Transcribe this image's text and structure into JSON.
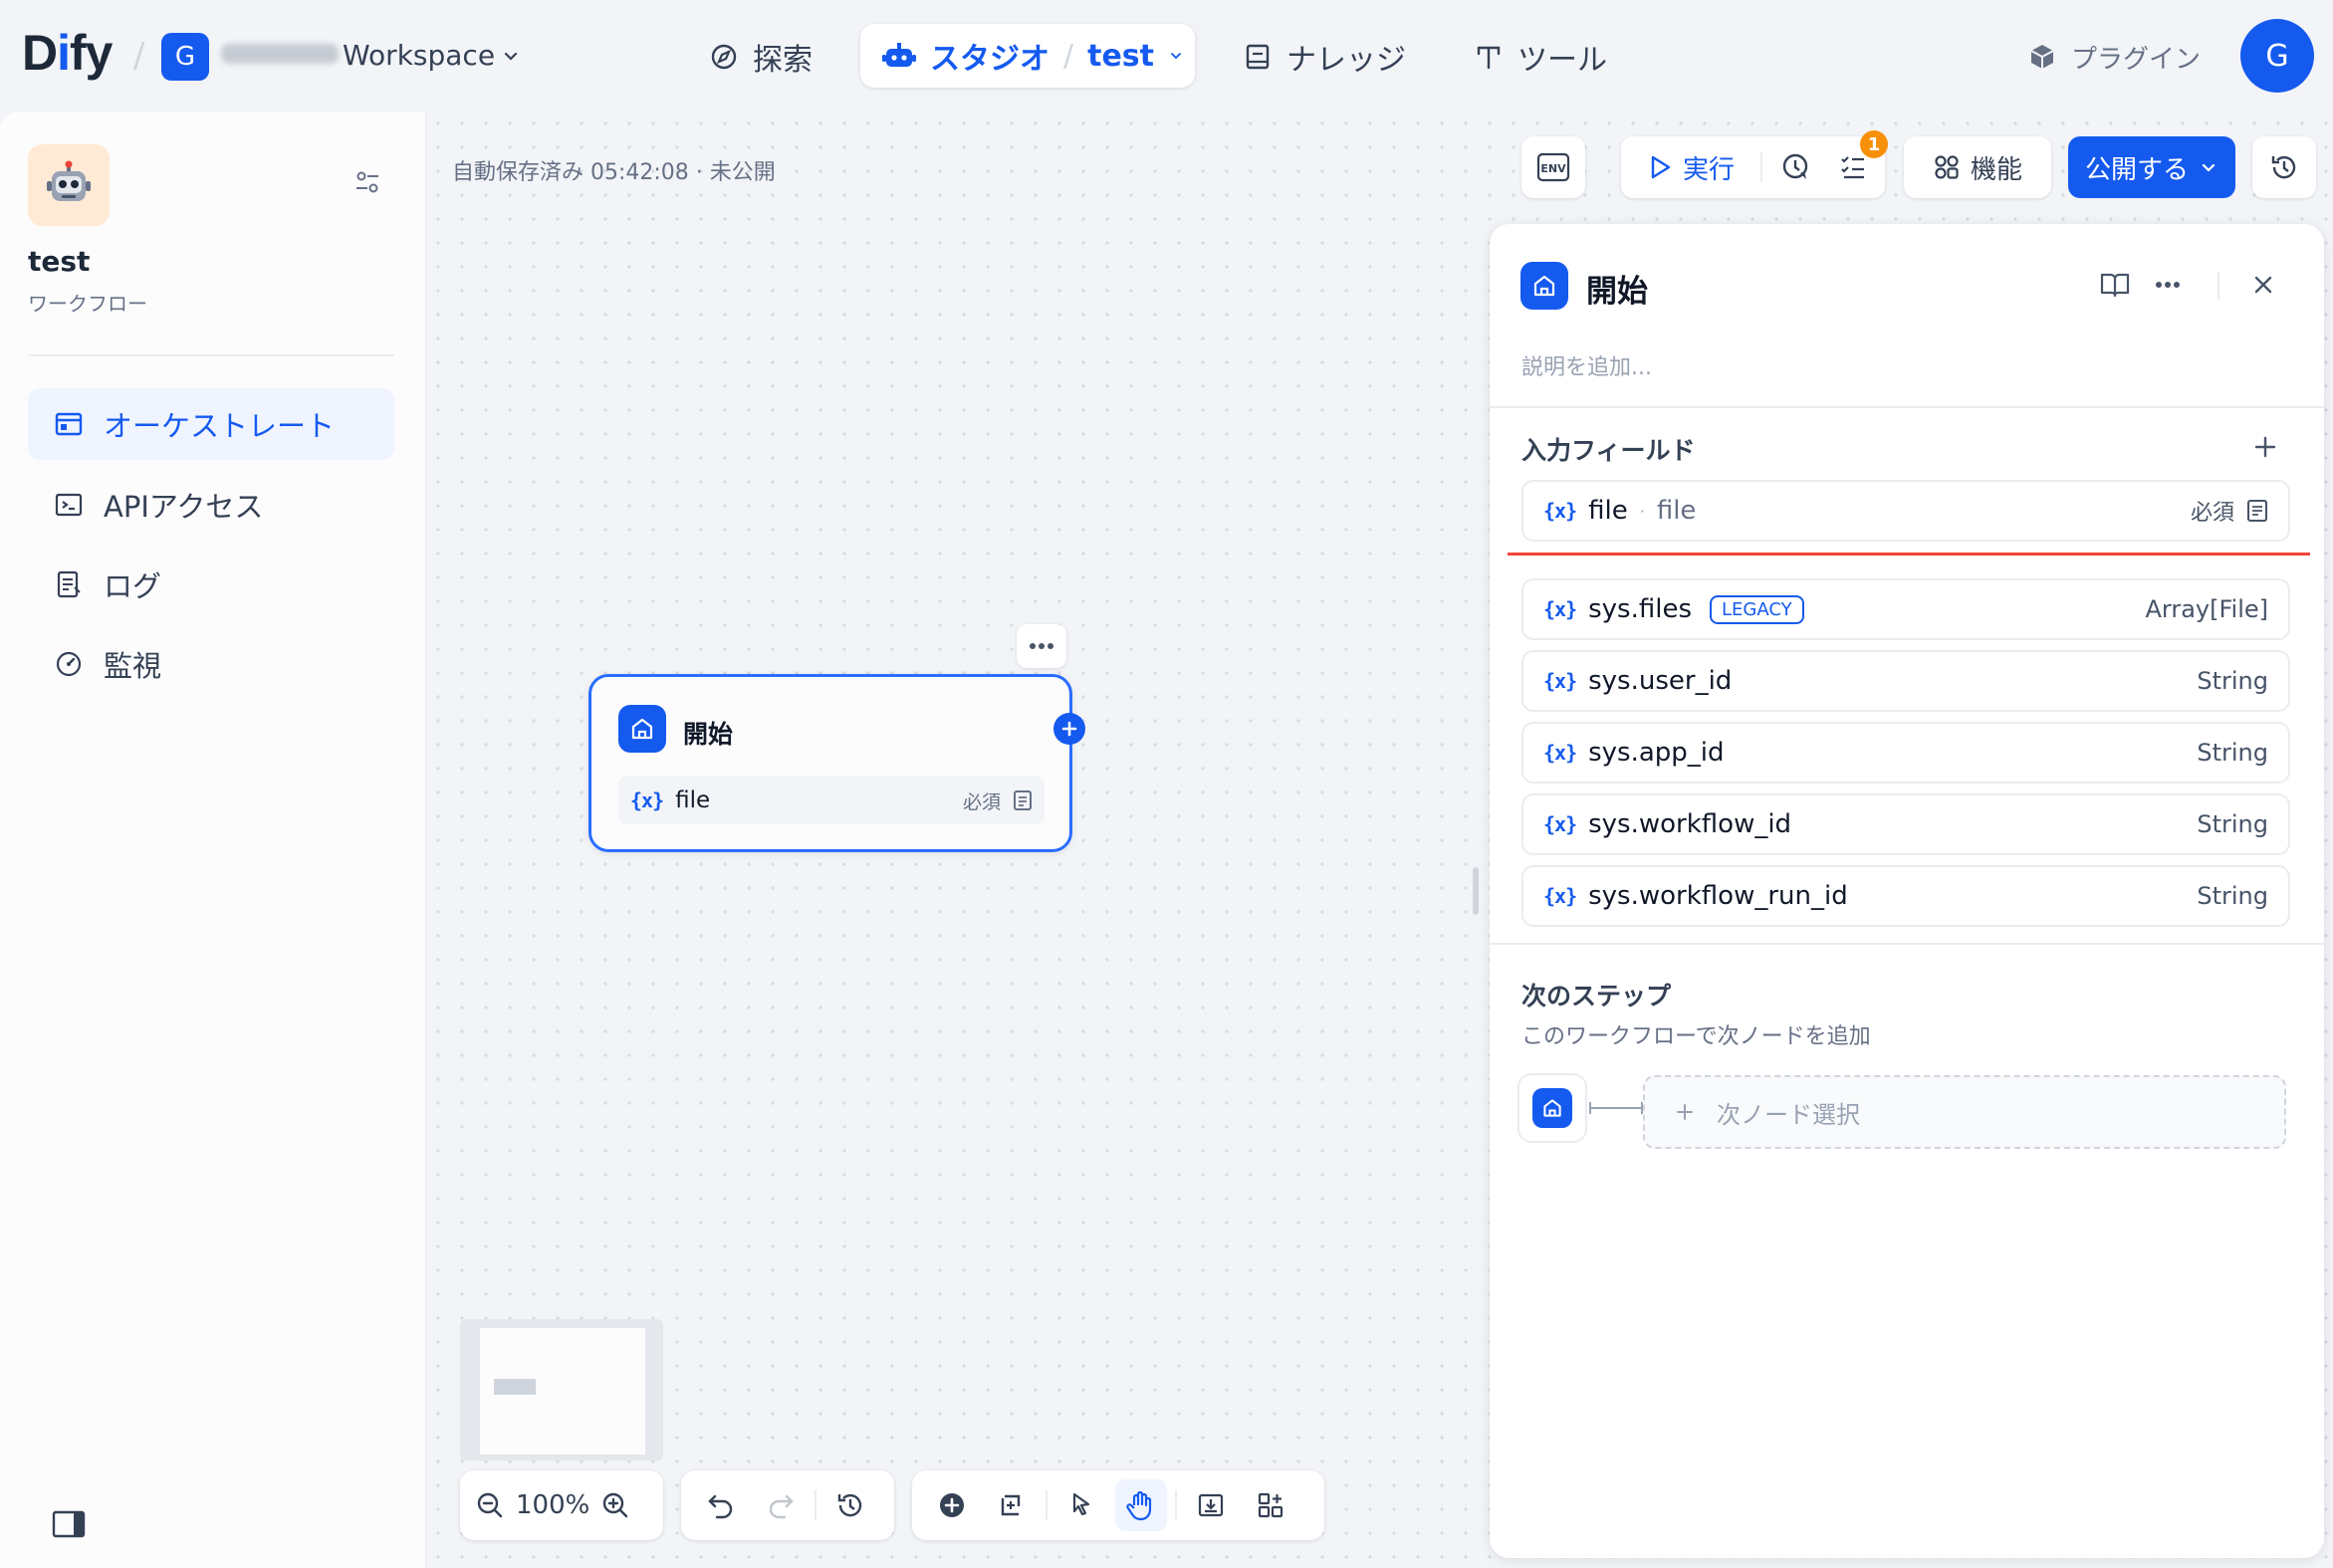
{
  "topnav": {
    "logo": {
      "part1": "D",
      "part2": "i",
      "part3": "fy"
    },
    "workspace": {
      "initial": "G",
      "name": "Workspace"
    },
    "explore_label": "探索",
    "studio_label": "スタジオ",
    "studio_app": "test",
    "knowledge_label": "ナレッジ",
    "tools_label": "ツール",
    "plugins_label": "プラグイン",
    "user_initial": "G"
  },
  "sidebar": {
    "app_name": "test",
    "app_type": "ワークフロー",
    "items": [
      {
        "label": "オーケストレート",
        "active": true
      },
      {
        "label": "APIアクセス",
        "active": false
      },
      {
        "label": "ログ",
        "active": false
      },
      {
        "label": "監視",
        "active": false
      }
    ]
  },
  "toolbar": {
    "autosave_text": "自動保存済み 05:42:08 · 未公開",
    "env_label": "ENV",
    "run_label": "実行",
    "checklist_badge": "1",
    "features_label": "機能",
    "publish_label": "公開する"
  },
  "node": {
    "title": "開始",
    "var_name": "file",
    "var_required": "必須"
  },
  "bottom": {
    "zoom": "100%"
  },
  "panel": {
    "title": "開始",
    "description_placeholder": "説明を追加...",
    "input_fields_title": "入力フィールド",
    "user_var": {
      "name": "file",
      "label": "file",
      "required": "必須"
    },
    "sys_vars": [
      {
        "name": "sys.files",
        "badge": "LEGACY",
        "type": "Array[File]"
      },
      {
        "name": "sys.user_id",
        "type": "String"
      },
      {
        "name": "sys.app_id",
        "type": "String"
      },
      {
        "name": "sys.workflow_id",
        "type": "String"
      },
      {
        "name": "sys.workflow_run_id",
        "type": "String"
      }
    ],
    "next_step_title": "次のステップ",
    "next_step_desc": "このワークフローで次ノードを追加",
    "next_node_select": "次ノード選択"
  },
  "colors": {
    "accent": "#155aef",
    "badge": "#f79009",
    "error_line": "#f04438"
  }
}
